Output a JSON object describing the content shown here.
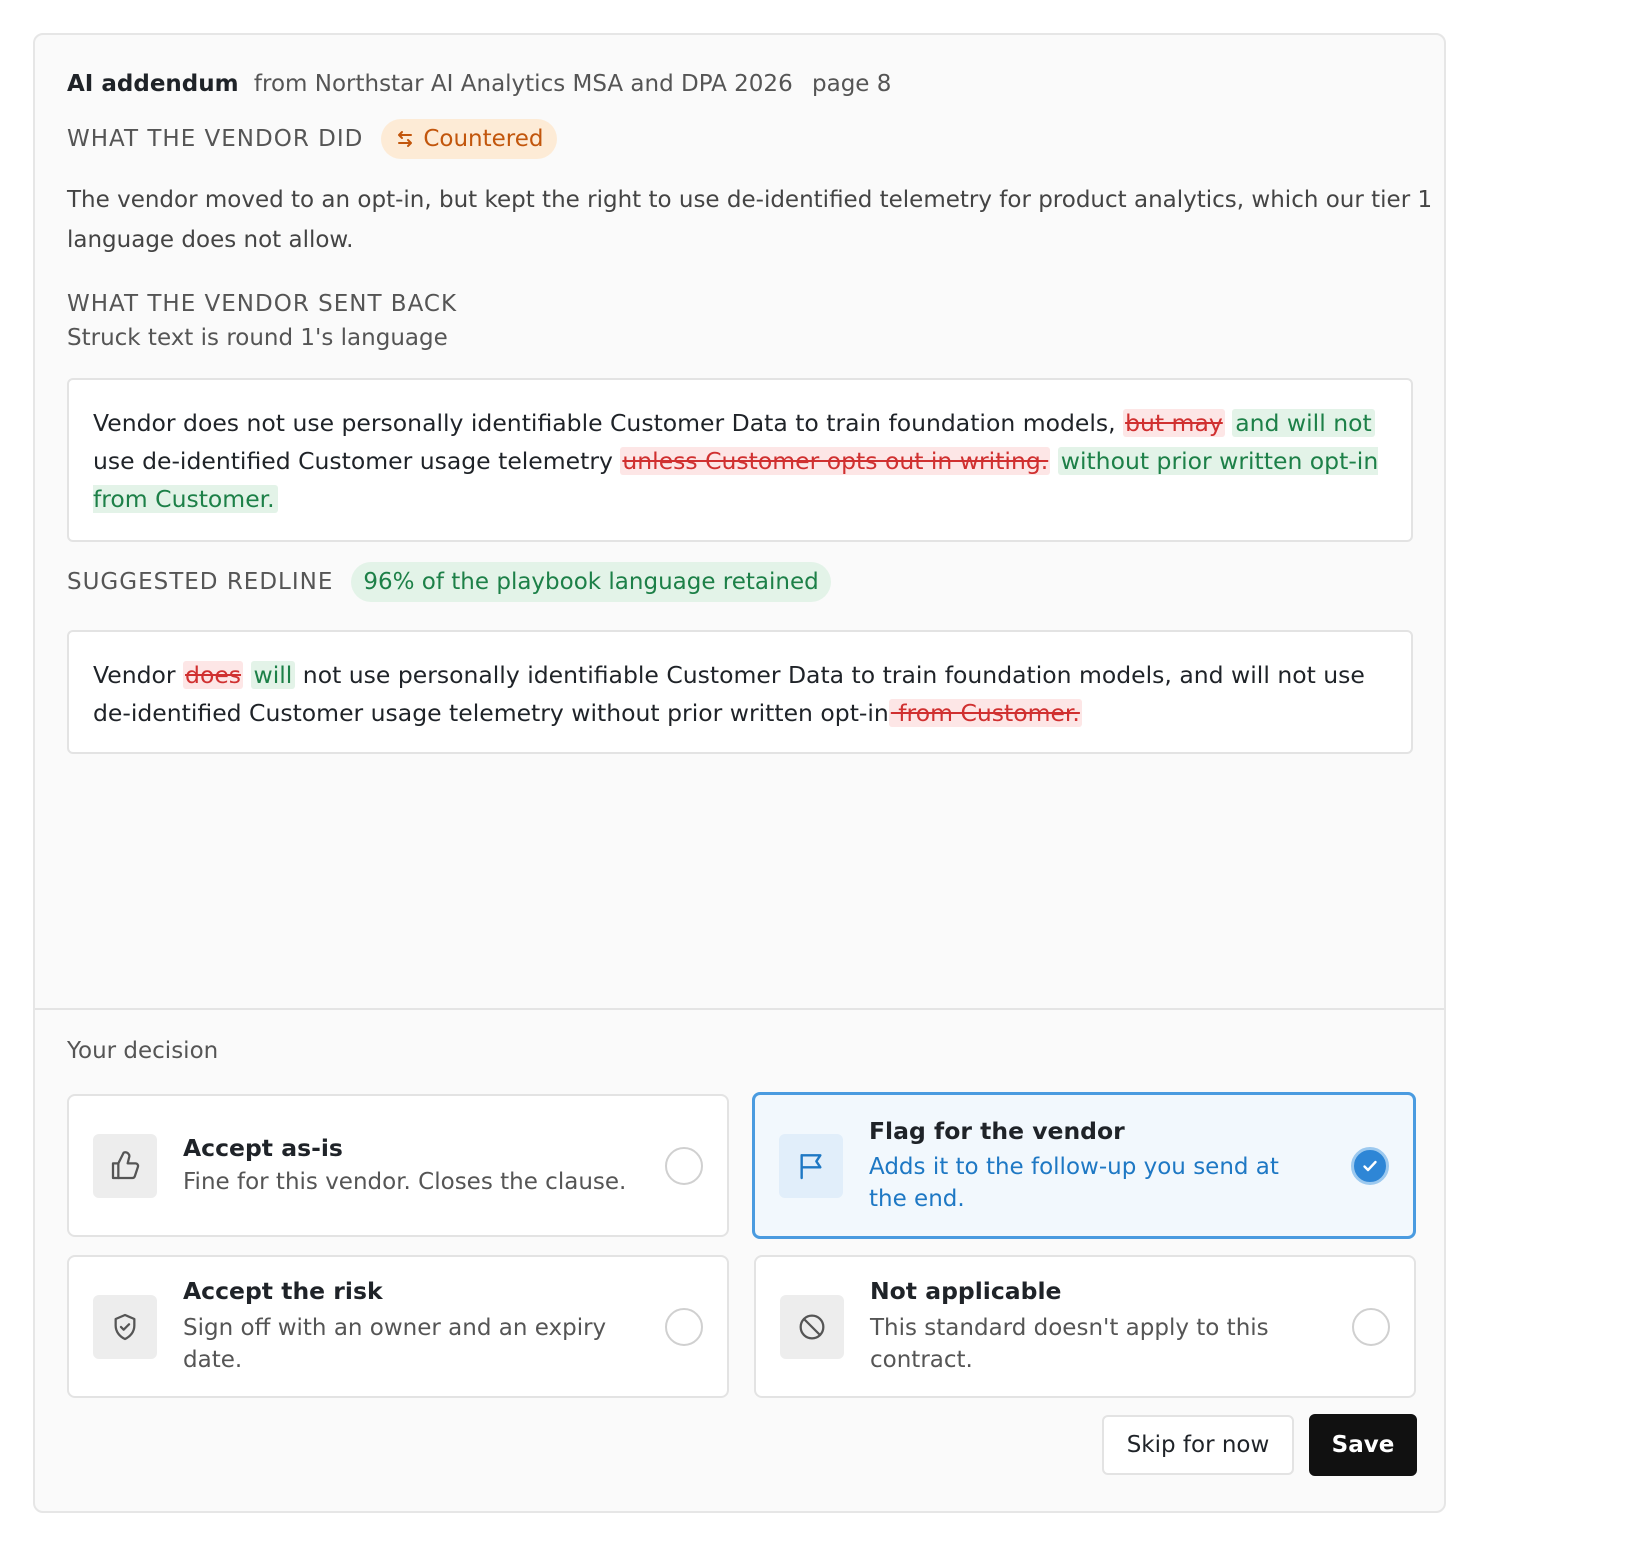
{
  "header": {
    "document_type": "AI addendum",
    "source": "from Northstar AI Analytics MSA and DPA 2026",
    "page": "page 8"
  },
  "vendor_action": {
    "label": "WHAT THE VENDOR DID",
    "status_icon": "swap-arrows-icon",
    "status": "Countered",
    "status_color": "#c2560c",
    "description": "The vendor moved to an opt-in, but kept the right to use de-identified telemetry for product analytics, which our tier 1 language does not allow."
  },
  "sent_back": {
    "label": "WHAT THE VENDOR SENT BACK",
    "note": "Struck text is round 1's language",
    "segments": [
      {
        "text": "Vendor does not use personally identifiable Customer Data to train foundation models, ",
        "kind": "plain"
      },
      {
        "text": "but may",
        "kind": "deleted"
      },
      {
        "text": " ",
        "kind": "plain"
      },
      {
        "text": "and will not",
        "kind": "inserted"
      },
      {
        "text": " use de-identified Customer usage telemetry ",
        "kind": "plain"
      },
      {
        "text": "unless Customer opts out in writing.",
        "kind": "deleted"
      },
      {
        "text": " ",
        "kind": "plain"
      },
      {
        "text": "without prior written opt-in from Customer.",
        "kind": "inserted"
      }
    ]
  },
  "suggested": {
    "label": "SUGGESTED REDLINE",
    "retention_badge": "96% of the playbook language retained",
    "segments": [
      {
        "text": "Vendor ",
        "kind": "plain"
      },
      {
        "text": "does",
        "kind": "deleted"
      },
      {
        "text": " ",
        "kind": "plain"
      },
      {
        "text": "will",
        "kind": "inserted"
      },
      {
        "text": " not use personally identifiable Customer Data to train foundation models, and will not use de-identified Customer usage telemetry without prior written opt-in",
        "kind": "plain"
      },
      {
        "text": " from Customer.",
        "kind": "deleted"
      }
    ]
  },
  "decision": {
    "label": "Your decision",
    "selected": "flag",
    "options": [
      {
        "id": "accept",
        "title": "Accept as-is",
        "description": "Fine for this vendor. Closes the clause.",
        "icon": "thumbs-up-icon"
      },
      {
        "id": "flag",
        "title": "Flag for the vendor",
        "description": "Adds it to the follow-up you send at the end.",
        "icon": "flag-icon"
      },
      {
        "id": "risk",
        "title": "Accept the risk",
        "description": "Sign off with an owner and an expiry date.",
        "icon": "shield-check-icon"
      },
      {
        "id": "na",
        "title": "Not applicable",
        "description": "This standard doesn't apply to this contract.",
        "icon": "ban-icon"
      }
    ]
  },
  "actions": {
    "skip_label": "Skip for now",
    "save_label": "Save"
  },
  "colors": {
    "accent_blue": "#2e86d6",
    "deleted_red": "#d03030",
    "inserted_green": "#1d8048"
  }
}
